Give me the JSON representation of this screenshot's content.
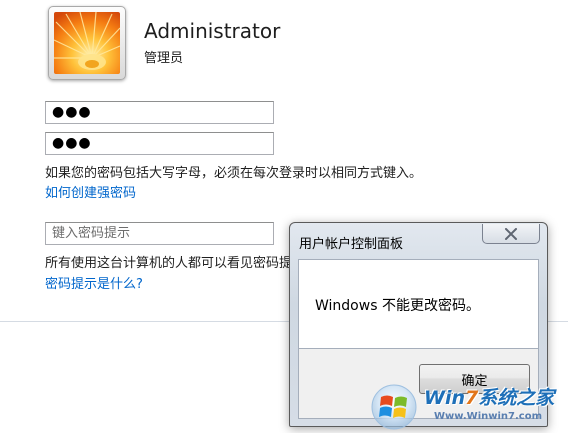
{
  "user": {
    "name": "Administrator",
    "role": "管理员"
  },
  "password_fields": {
    "new_password_mask": "●●●",
    "confirm_password_mask": "●●●"
  },
  "caps_note": "如果您的密码包括大写字母，必须在每次登录时以相同方式键入。",
  "strong_password_link": "如何创建强密码",
  "hint": {
    "placeholder": "键入密码提示",
    "note": "所有使用这台计算机的人都可以看见密码提示。",
    "link": "密码提示是什么?"
  },
  "dialog": {
    "title": "用户帐户控制面板",
    "message": "Windows 不能更改密码。",
    "ok_label": "确定",
    "close_icon": "close-icon"
  },
  "watermark": {
    "brand_prefix": "Win",
    "brand_digit": "7",
    "brand_suffix": "系统之家",
    "url": "Www.Winwin7.com"
  },
  "colors": {
    "link": "#0066cc",
    "dialog_frame": "#cfd8e2",
    "watermark_blue": "#1d6fb8",
    "watermark_orange": "#e2761b"
  }
}
